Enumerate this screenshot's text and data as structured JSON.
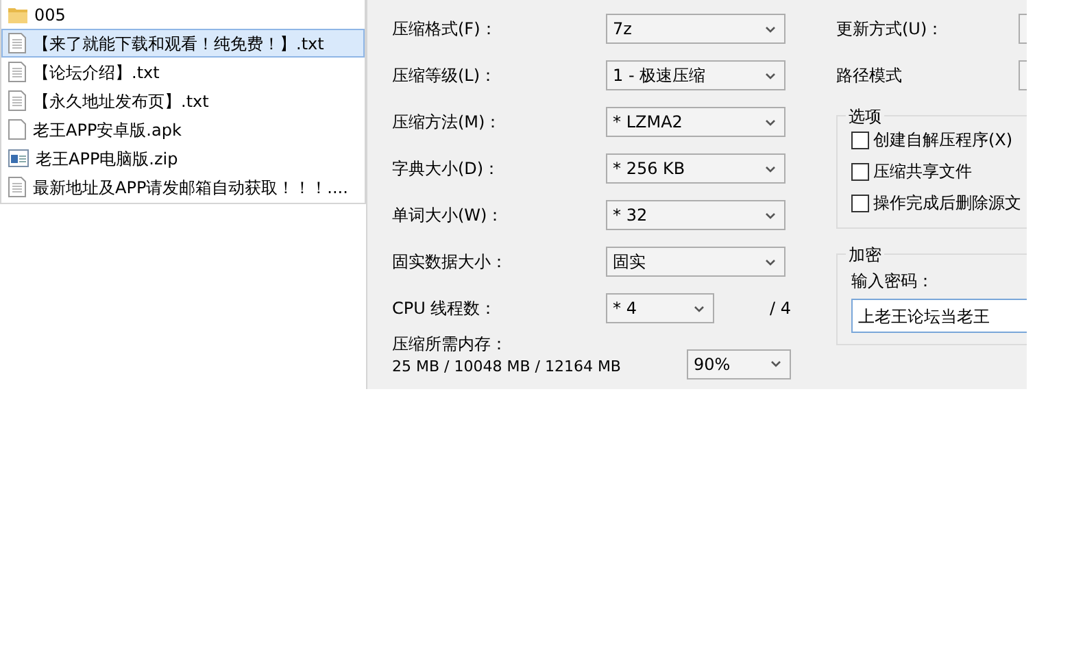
{
  "file_list": [
    {
      "kind": "folder",
      "name": "005",
      "selected": false
    },
    {
      "kind": "text",
      "name": "【来了就能下载和观看！纯免费！】.txt",
      "selected": true
    },
    {
      "kind": "text",
      "name": "【论坛介绍】.txt",
      "selected": false
    },
    {
      "kind": "text",
      "name": "【永久地址发布页】.txt",
      "selected": false
    },
    {
      "kind": "blank",
      "name": "老王APP安卓版.apk",
      "selected": false
    },
    {
      "kind": "archive",
      "name": "老王APP电脑版.zip",
      "selected": false
    },
    {
      "kind": "text",
      "name": "最新地址及APP请发邮箱自动获取！！！....",
      "selected": false
    }
  ],
  "settings": [
    {
      "label": "压缩格式(F)：",
      "value": "7z",
      "kind": "wide"
    },
    {
      "label": "压缩等级(L)：",
      "value": "1 - 极速压缩",
      "kind": "wide"
    },
    {
      "label": "压缩方法(M)：",
      "value": "* LZMA2",
      "kind": "wide"
    },
    {
      "label": "字典大小(D)：",
      "value": "* 256 KB",
      "kind": "wide"
    },
    {
      "label": "单词大小(W)：",
      "value": "* 32",
      "kind": "wide"
    },
    {
      "label": "固实数据大小：",
      "value": "固实",
      "kind": "wide"
    },
    {
      "label": "CPU 线程数：",
      "value": "* 4",
      "kind": "narrow",
      "suffix": "/ 4"
    }
  ],
  "memory": {
    "label": "压缩所需内存：",
    "reading": "25 MB / 10048 MB / 12164 MB",
    "value": "90%"
  },
  "right_settings": [
    {
      "label": "更新方式(U)："
    },
    {
      "label": "路径模式"
    }
  ],
  "options": {
    "title": "选项",
    "items": [
      {
        "label": "创建自解压程序(X)",
        "checked": false
      },
      {
        "label": "压缩共享文件",
        "checked": false
      },
      {
        "label": "操作完成后删除源文",
        "checked": false
      }
    ]
  },
  "encryption": {
    "title": "加密",
    "label": "输入密码：",
    "value": "上老王论坛当老王"
  }
}
